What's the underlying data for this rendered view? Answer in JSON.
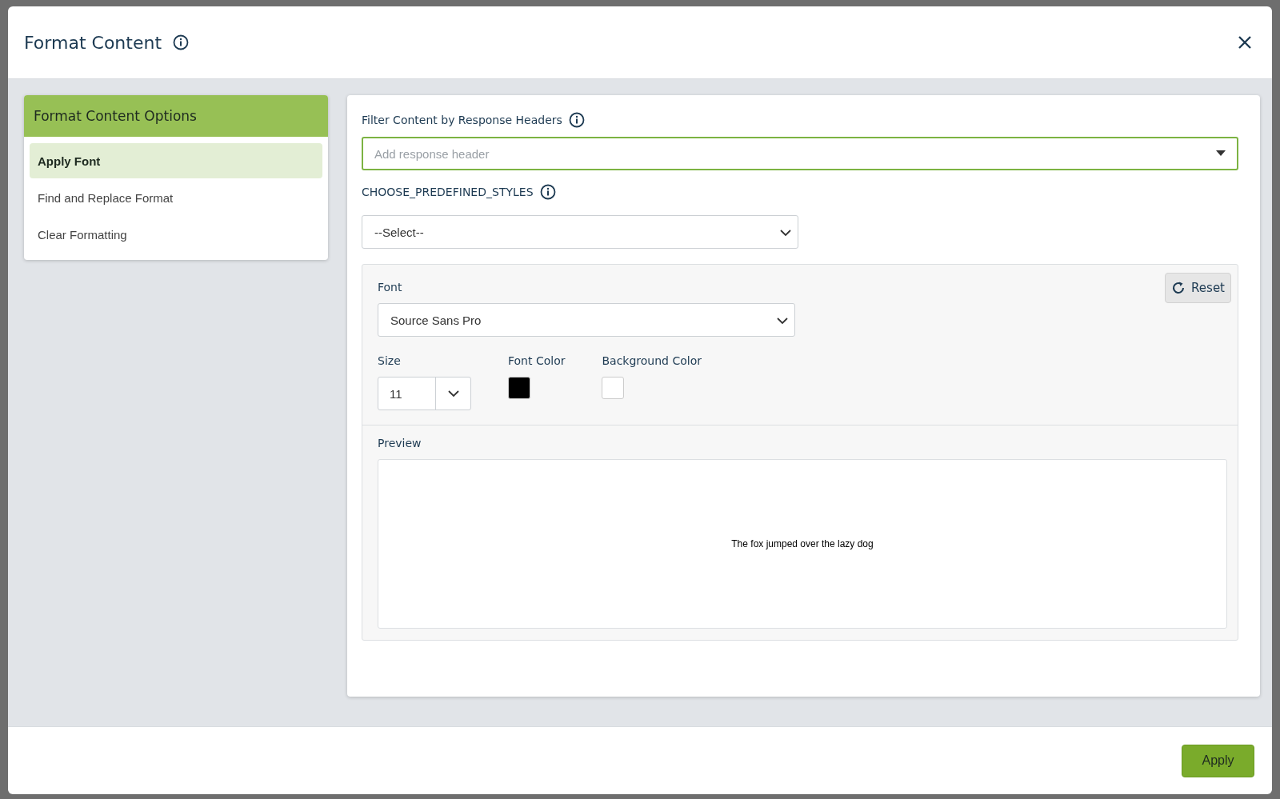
{
  "dialog": {
    "title": "Format Content"
  },
  "options": {
    "title": "Format Content Options",
    "items": [
      {
        "label": "Apply Font",
        "selected": true
      },
      {
        "label": "Find and Replace Format",
        "selected": false
      },
      {
        "label": "Clear Formatting",
        "selected": false
      }
    ]
  },
  "filter": {
    "label": "Filter Content by Response Headers",
    "placeholder": "Add response header"
  },
  "predefined_styles": {
    "label": "CHOOSE_PREDEFINED_STYLES",
    "value": "--Select--"
  },
  "font": {
    "label": "Font",
    "value": "Source Sans Pro"
  },
  "size": {
    "label": "Size",
    "value": "11"
  },
  "font_color": {
    "label": "Font Color",
    "color": "#000000"
  },
  "background_color": {
    "label": "Background Color",
    "color": "#ffffff"
  },
  "reset_button": "Reset",
  "preview": {
    "label": "Preview",
    "text": "The fox jumped over the lazy dog"
  },
  "apply_button": "Apply"
}
